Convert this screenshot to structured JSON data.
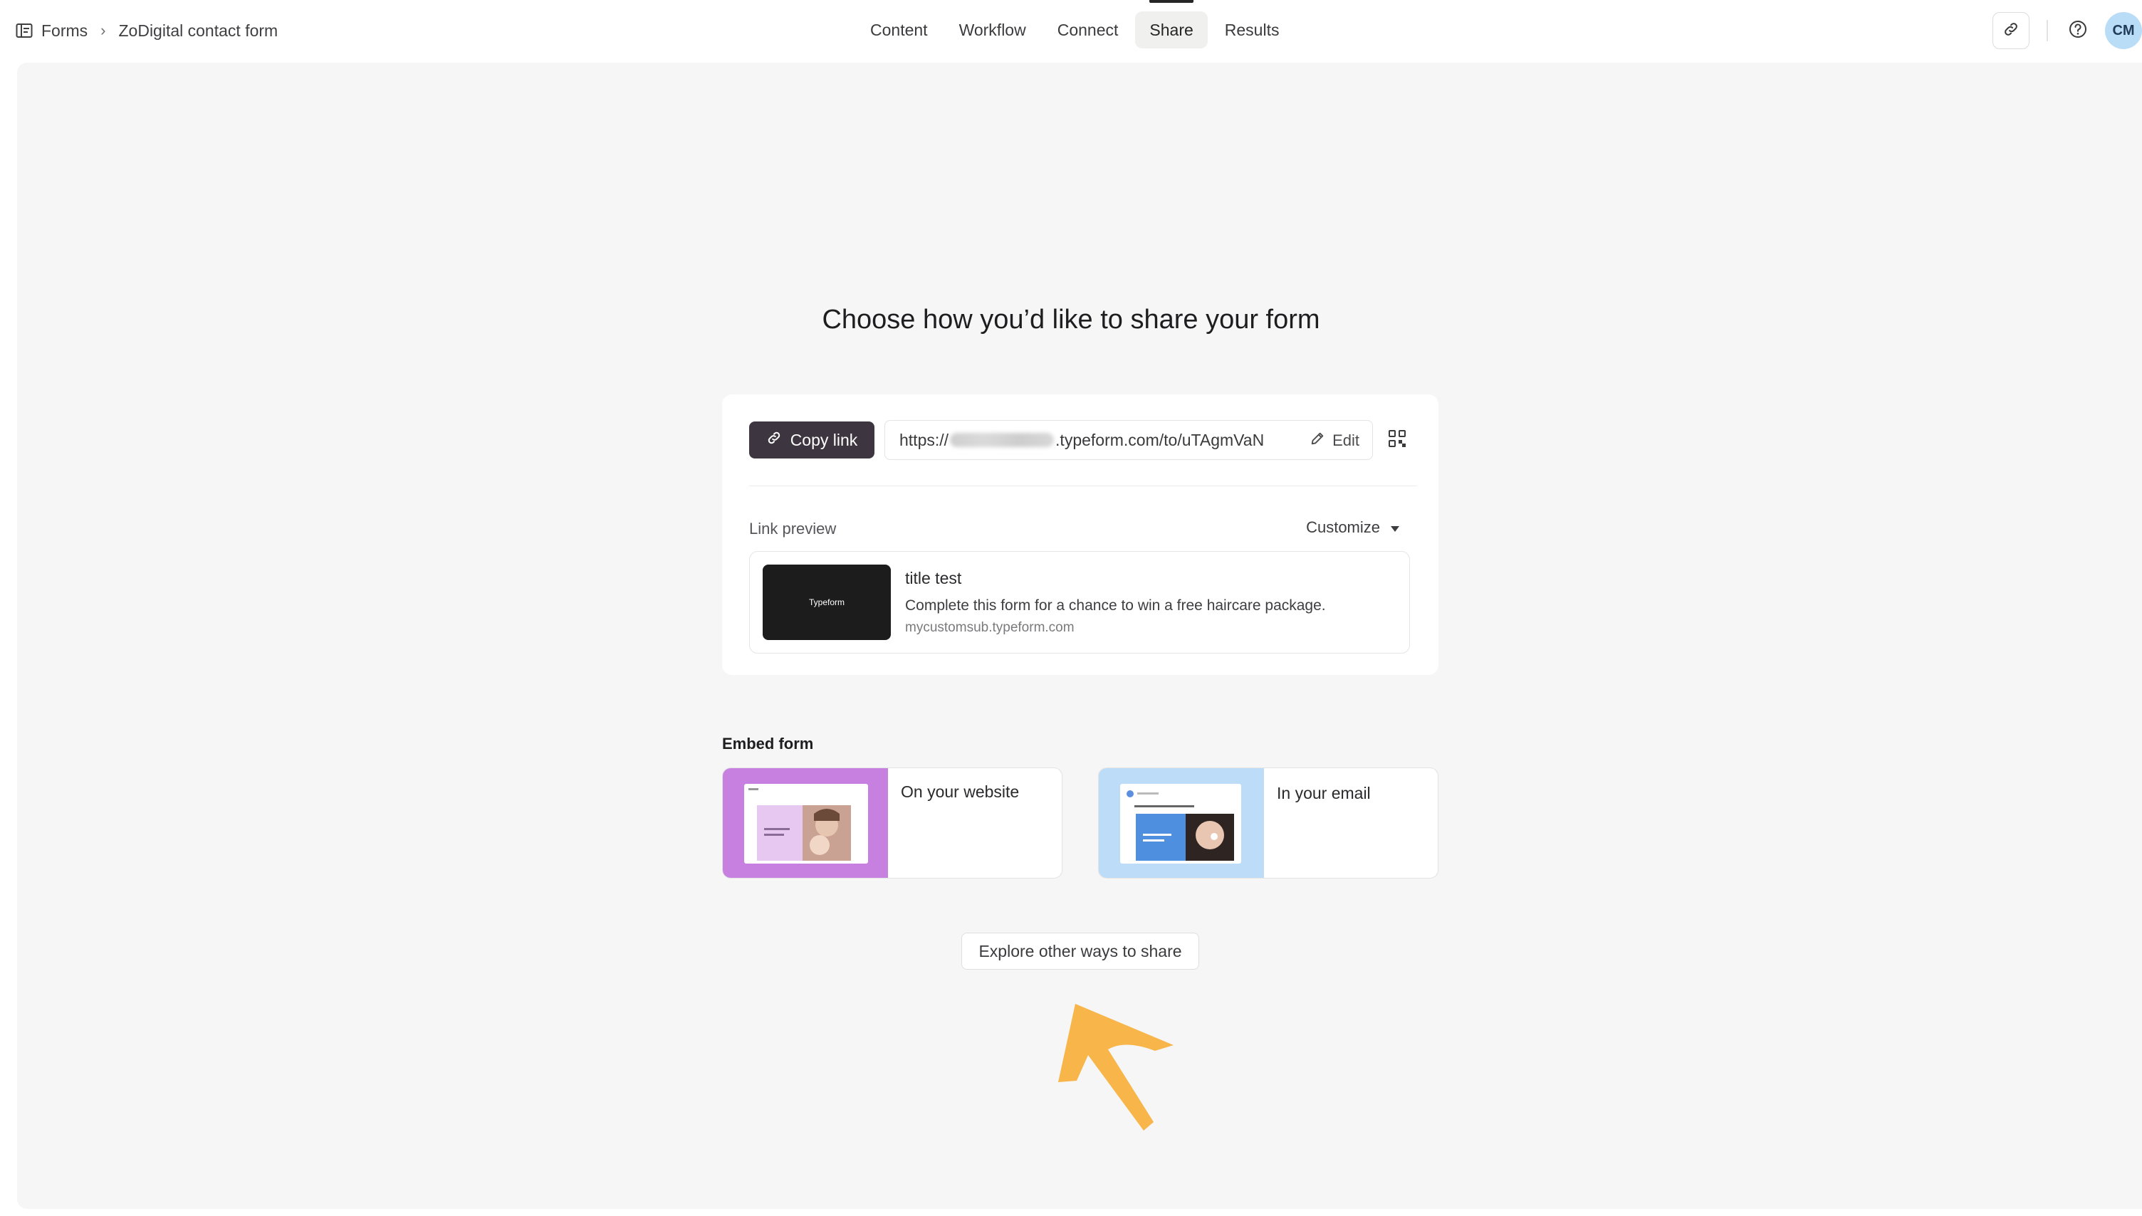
{
  "breadcrumb": {
    "root_label": "Forms",
    "separator": "›",
    "current_label": "ZoDigital contact form"
  },
  "tabs": [
    {
      "label": "Content",
      "active": false
    },
    {
      "label": "Workflow",
      "active": false
    },
    {
      "label": "Connect",
      "active": false
    },
    {
      "label": "Share",
      "active": true
    },
    {
      "label": "Results",
      "active": false
    }
  ],
  "header_actions": {
    "link_icon": "link-icon",
    "help_icon": "help-icon",
    "avatar_initials": "CM"
  },
  "page": {
    "heading": "Choose how you’d like to share your form"
  },
  "share_link": {
    "copy_label": "Copy link",
    "url_prefix": "https://",
    "url_suffix": ".typeform.com/to/uTAgmVaN",
    "url_blurred": true,
    "edit_label": "Edit",
    "qr_icon": "qr-code-icon"
  },
  "link_preview": {
    "label": "Link preview",
    "customize_label": "Customize",
    "thumbnail_text": "Typeform",
    "title": "title test",
    "description": "Complete this form for a chance to win a free haircare package.",
    "url": "mycustomsub.typeform.com"
  },
  "embed": {
    "title": "Embed form",
    "options": [
      {
        "label": "On your website",
        "accent": "#c77fe0"
      },
      {
        "label": "In your email",
        "accent": "#bcdcf8"
      }
    ]
  },
  "explore_label": "Explore other ways to share",
  "colors": {
    "primary_button": "#3d3540",
    "canvas_bg": "#f6f6f6",
    "avatar_bg": "#b9dcf7",
    "annotation_arrow": "#f7b54a"
  }
}
